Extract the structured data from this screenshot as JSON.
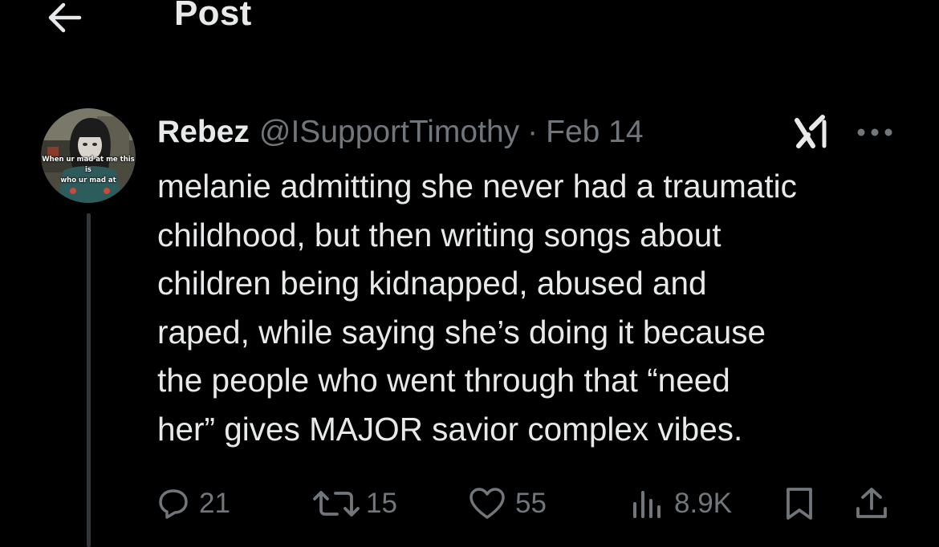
{
  "header": {
    "title": "Post",
    "back_icon": "arrow-left-icon"
  },
  "tweet": {
    "avatar": {
      "caption_line1": "When ur mad at me this is",
      "caption_line2": "who ur mad at"
    },
    "display_name": "Rebez",
    "handle": "@ISupportTimothy",
    "separator": "·",
    "date": "Feb 14",
    "text": "melanie admitting she never had a traumatic\nchildhood, but then writing songs about\nchildren being kidnapped, abused and\nraped, while saying she’s doing it because\nthe people who went through that “need\nher” gives MAJOR savior complex vibes.",
    "icons": {
      "grok": "grok-icon",
      "more": "more-dots-icon"
    }
  },
  "actions": {
    "replies": "21",
    "reposts": "15",
    "likes": "55",
    "views": "8.9K",
    "icons": [
      "reply-icon",
      "repost-icon",
      "like-icon",
      "views-icon",
      "bookmark-icon",
      "share-icon"
    ]
  },
  "colors": {
    "background": "#000000",
    "text_primary": "#e7e9ea",
    "text_secondary": "#71767b",
    "thread_line": "#333639"
  }
}
